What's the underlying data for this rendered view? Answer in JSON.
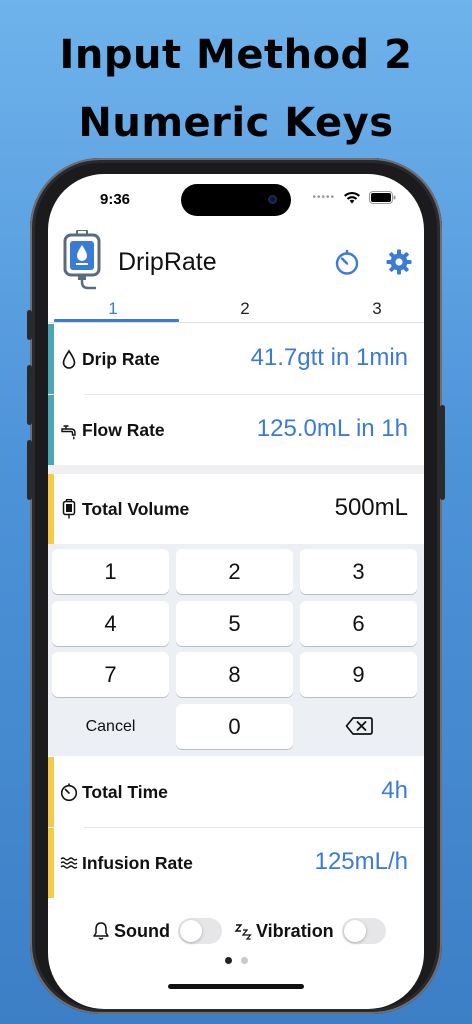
{
  "promo": {
    "line1": "Input Method 2",
    "line2": "Numeric Keys"
  },
  "status": {
    "time": "9:36",
    "dots": "•••••"
  },
  "header": {
    "title": "DripRate",
    "timer_icon": "timer-icon",
    "settings_icon": "gear-icon"
  },
  "tabs": [
    {
      "label": "1"
    },
    {
      "label": "2"
    },
    {
      "label": "3"
    }
  ],
  "rows": {
    "drip_rate": {
      "label": "Drip Rate",
      "value": "41.7gtt in 1min"
    },
    "flow_rate": {
      "label": "Flow Rate",
      "value": "125.0mL in 1h"
    },
    "total_volume": {
      "label": "Total Volume",
      "value": "500mL"
    },
    "total_time": {
      "label": "Total Time",
      "value": "4h"
    },
    "infusion_rate": {
      "label": "Infusion Rate",
      "value": "125mL/h"
    }
  },
  "keypad": {
    "keys": [
      "1",
      "2",
      "3",
      "4",
      "5",
      "6",
      "7",
      "8",
      "9"
    ],
    "cancel": "Cancel",
    "zero": "0"
  },
  "bottom": {
    "sound_label": "Sound",
    "vibration_label": "Vibration",
    "sound_prefix_icon": "bell-icon",
    "vibration_prefix": "zzz"
  },
  "colors": {
    "accent": "#3a7bd5",
    "stripe_teal": "#4aa6b4",
    "stripe_yellow": "#f7c948",
    "background_top": "#6fb3ec",
    "background_bottom": "#3d7fc6"
  }
}
